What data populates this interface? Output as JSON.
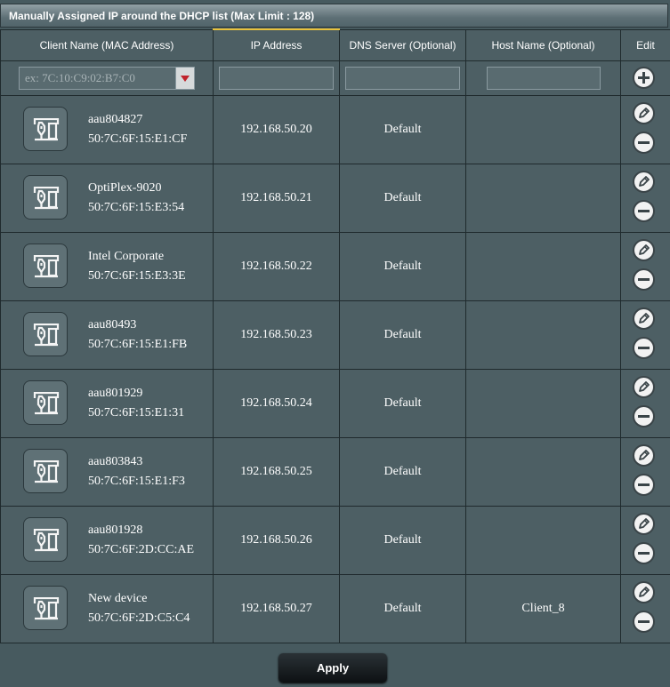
{
  "title": "Manually Assigned IP around the DHCP list (Max Limit : 128)",
  "columns": {
    "client": "Client Name (MAC Address)",
    "ip": "IP Address",
    "dns": "DNS Server (Optional)",
    "host": "Host Name (Optional)",
    "edit": "Edit"
  },
  "inputs": {
    "mac_placeholder": "ex: 7C:10:C9:02:B7:C0",
    "ip_value": "",
    "dns_value": "",
    "host_value": ""
  },
  "icons": {
    "device": "device-icon",
    "dropdown": "dropdown-arrow-icon",
    "add": "plus-circle-icon",
    "edit": "pencil-icon",
    "delete": "minus-circle-icon"
  },
  "rows": [
    {
      "name": "aau804827",
      "mac": "50:7C:6F:15:E1:CF",
      "ip": "192.168.50.20",
      "dns": "Default",
      "host": ""
    },
    {
      "name": "OptiPlex-9020",
      "mac": "50:7C:6F:15:E3:54",
      "ip": "192.168.50.21",
      "dns": "Default",
      "host": ""
    },
    {
      "name": "Intel Corporate",
      "mac": "50:7C:6F:15:E3:3E",
      "ip": "192.168.50.22",
      "dns": "Default",
      "host": ""
    },
    {
      "name": "aau80493",
      "mac": "50:7C:6F:15:E1:FB",
      "ip": "192.168.50.23",
      "dns": "Default",
      "host": ""
    },
    {
      "name": "aau801929",
      "mac": "50:7C:6F:15:E1:31",
      "ip": "192.168.50.24",
      "dns": "Default",
      "host": ""
    },
    {
      "name": "aau803843",
      "mac": "50:7C:6F:15:E1:F3",
      "ip": "192.168.50.25",
      "dns": "Default",
      "host": ""
    },
    {
      "name": "aau801928",
      "mac": "50:7C:6F:2D:CC:AE",
      "ip": "192.168.50.26",
      "dns": "Default",
      "host": ""
    },
    {
      "name": "New device",
      "mac": "50:7C:6F:2D:C5:C4",
      "ip": "192.168.50.27",
      "dns": "Default",
      "host": "Client_8"
    }
  ],
  "apply_label": "Apply",
  "colors": {
    "panel": "#475a5f",
    "border": "#1f2a2d",
    "accent": "#e9c23c",
    "dropdown_arrow": "#c0232b"
  }
}
